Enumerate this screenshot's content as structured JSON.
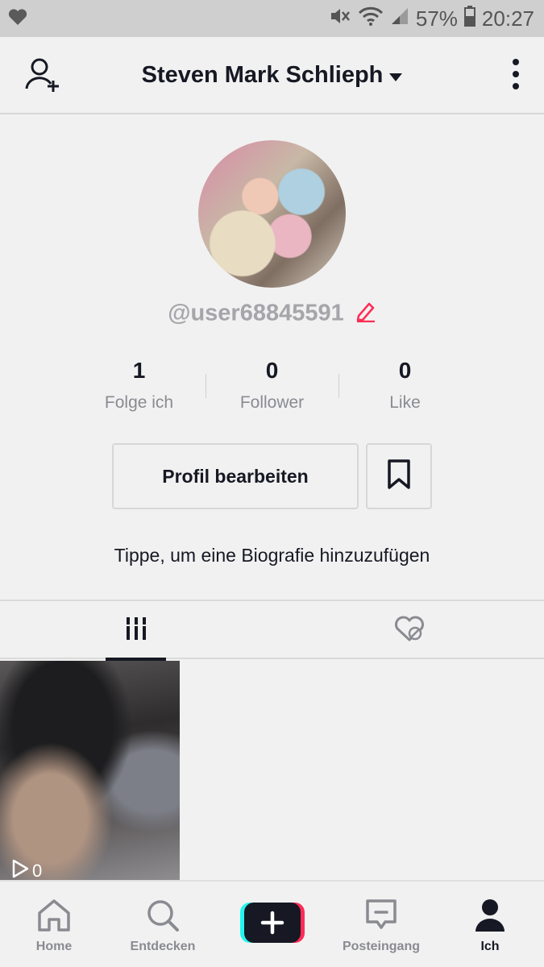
{
  "status_bar": {
    "battery_percent": "57%",
    "time": "20:27"
  },
  "header": {
    "title": "Steven Mark Schlieph"
  },
  "profile": {
    "username": "@user68845591",
    "stats": [
      {
        "value": "1",
        "label": "Folge ich"
      },
      {
        "value": "0",
        "label": "Follower"
      },
      {
        "value": "0",
        "label": "Like"
      }
    ],
    "edit_button_label": "Profil bearbeiten",
    "bio_prompt": "Tippe, um eine Biografie hinzuzufügen"
  },
  "videos": [
    {
      "views": "0"
    }
  ],
  "bottom_nav": [
    {
      "label": "Home",
      "icon": "home-icon"
    },
    {
      "label": "Entdecken",
      "icon": "search-icon"
    },
    {
      "label": "",
      "icon": "plus-icon"
    },
    {
      "label": "Posteingang",
      "icon": "inbox-icon"
    },
    {
      "label": "Ich",
      "icon": "profile-icon"
    }
  ],
  "colors": {
    "accent_red": "#fe2c55",
    "accent_cyan": "#25f4ee",
    "text_dark": "#161823",
    "text_muted": "#8a8b91"
  }
}
